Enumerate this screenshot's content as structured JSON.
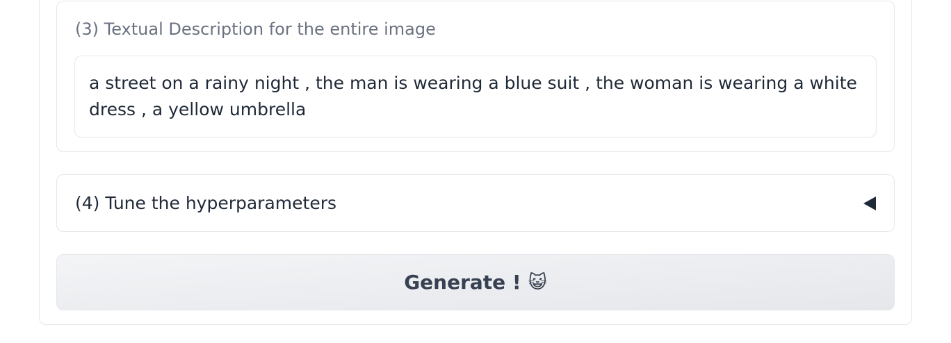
{
  "description_section": {
    "label": "(3) Textual Description for the entire image",
    "text": "a street on a rainy night , the man is wearing a blue suit , the woman is wearing a white dress , a yellow umbrella"
  },
  "hyperparameters_section": {
    "label": "(4) Tune the hyperparameters",
    "state": "collapsed"
  },
  "generate_button": {
    "label": "Generate !",
    "emoji": "😺"
  }
}
